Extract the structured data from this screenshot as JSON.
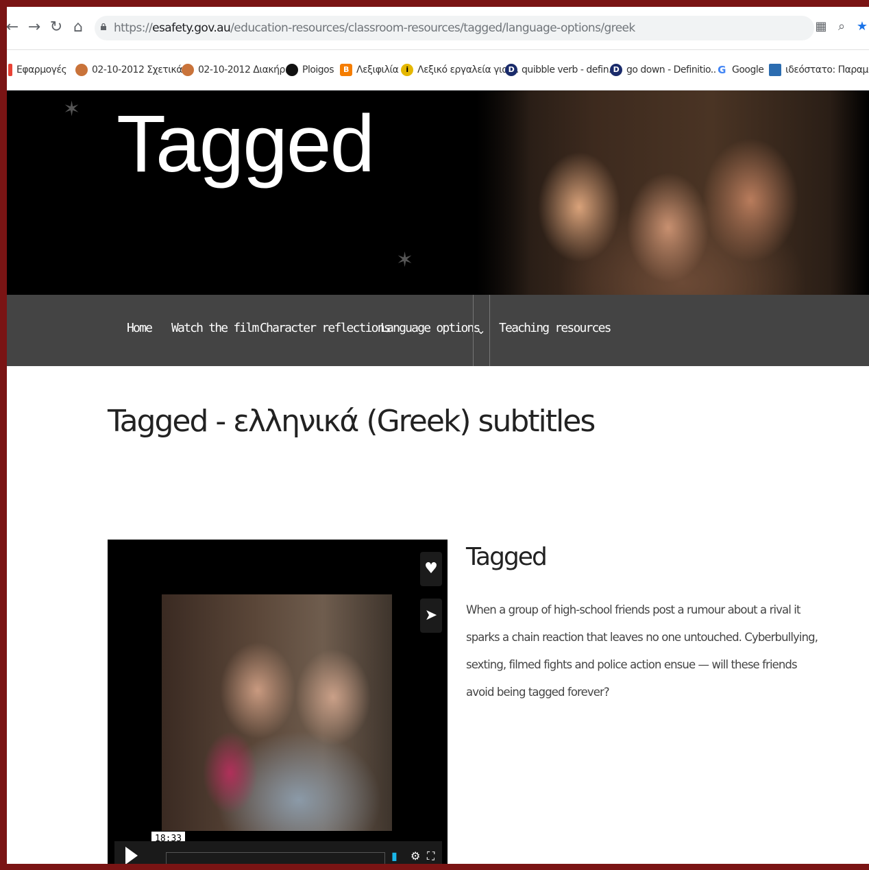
{
  "browser": {
    "url_prefix": "https://",
    "url_host": "esafety.gov.au",
    "url_path": "/education-resources/classroom-resources/tagged/language-options/greek",
    "back_icon": "arrow-left-icon",
    "forward_icon": "arrow-right-icon",
    "reload_icon": "reload-icon",
    "home_icon": "home-icon"
  },
  "bookmarks": [
    {
      "label": "Εφαρμογές",
      "icon": "apps-icon",
      "color": "#e94235"
    },
    {
      "label": "02-10-2012 Σχετικά ...",
      "icon": "doc-icon",
      "color": "#c9733a"
    },
    {
      "label": "02-10-2012 Διακήρ...",
      "icon": "doc-icon",
      "color": "#c9733a"
    },
    {
      "label": "Ploigos",
      "icon": "ploigos-icon",
      "color": "#111111"
    },
    {
      "label": "Λεξιφιλία",
      "icon": "blogger-icon",
      "color": "#f57d00"
    },
    {
      "label": "Λεξικό εργαλεία για ...",
      "icon": "info-icon",
      "color": "#e5b700"
    },
    {
      "label": "quibble verb - defin...",
      "icon": "dictionary-icon",
      "color": "#1a2b6b"
    },
    {
      "label": "go down - Definitio...",
      "icon": "dictionary-icon",
      "color": "#1a2b6b"
    },
    {
      "label": "Google",
      "icon": "google-icon",
      "color": "#4285f4"
    },
    {
      "label": "ιδεόστατο: Παραμύ...",
      "icon": "book-icon",
      "color": "#2b6cb0"
    }
  ],
  "hero": {
    "title": "Tagged"
  },
  "nav": {
    "items": [
      {
        "label": "Home"
      },
      {
        "label": "Watch the film"
      },
      {
        "label": "Character reflections"
      },
      {
        "label": "Language options"
      },
      {
        "label": "Teaching resources"
      }
    ],
    "dropdown_icon": "chevron-down-icon"
  },
  "main": {
    "page_title": "Tagged - ελληνικά (Greek) subtitles",
    "film_title": "Tagged",
    "film_description": "When a group of high-school friends post a rumour about a rival it sparks a chain reaction that leaves no one untouched. Cyberbullying, sexting, filmed fights and police action ensue — will these friends avoid being tagged forever?"
  },
  "video": {
    "duration": "18:33",
    "like_icon": "heart-icon",
    "share_icon": "send-icon",
    "volume_icon": "volume-icon",
    "settings_icon": "gear-icon",
    "fullscreen_icon": "fullscreen-icon"
  },
  "colors": {
    "nav_bg": "#444444",
    "hero_bg": "#000000",
    "border": "#7a1414"
  }
}
